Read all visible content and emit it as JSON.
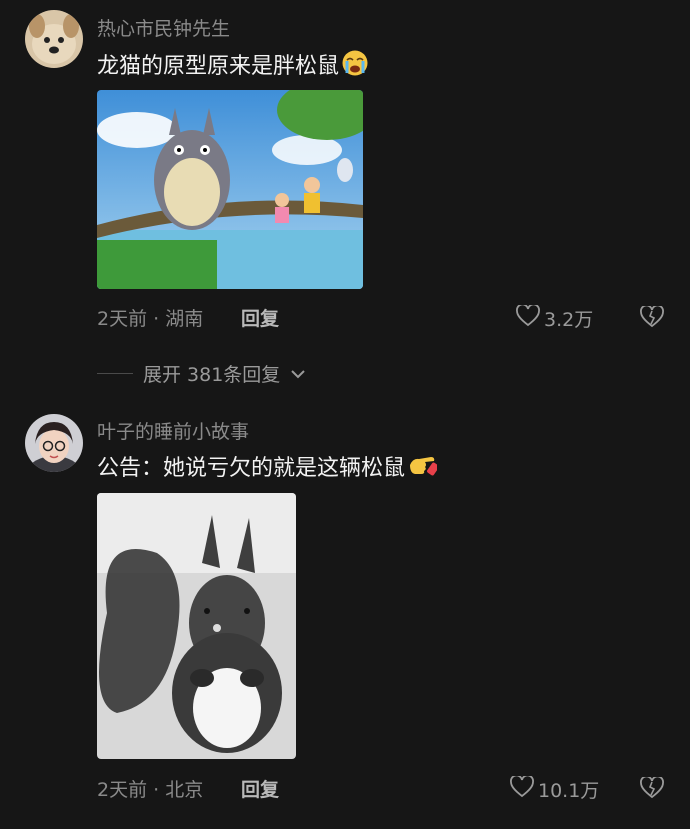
{
  "comments": [
    {
      "username": "热心市民钟先生",
      "text": "龙猫的原型原来是胖松鼠",
      "emoji": "crying-face-icon",
      "image": "totoro-fishing-image",
      "time": "2天前",
      "location": "湖南",
      "reply_label": "回复",
      "likes": "3.2万"
    },
    {
      "username": "叶子的睡前小故事",
      "text": "公告：她说亏欠的就是这辆松鼠",
      "emoji": "pointing-hand-icon",
      "image": "squirrel-photo",
      "time": "2天前",
      "location": "北京",
      "reply_label": "回复",
      "likes": "10.1万"
    }
  ],
  "expand_replies": "展开 381条回复",
  "colors": {
    "background": "#161616",
    "secondary_text": "#8a8a8a",
    "primary_text": "#f2f2f2"
  }
}
